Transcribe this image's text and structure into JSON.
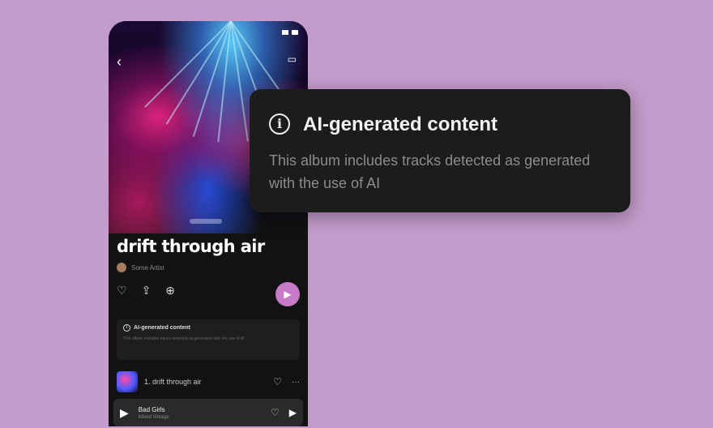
{
  "popup": {
    "title": "AI-generated content",
    "description": "This album includes tracks detected as generated with the use of AI",
    "icon": "info-icon"
  },
  "phone": {
    "album_title": "drift through air",
    "artist_name": "Some Artist",
    "ai_card": {
      "title": "AI-generated content",
      "text": "This album includes tracks detected as generated with the use of AI"
    },
    "track": {
      "label": "1. drift through air"
    },
    "now_playing": {
      "title": "Bad Girls",
      "artist": "Mixed Vintage"
    },
    "accent_color": "#c77ac8"
  },
  "colors": {
    "background": "#c49ccb",
    "popup_bg": "#1c1c1c"
  }
}
